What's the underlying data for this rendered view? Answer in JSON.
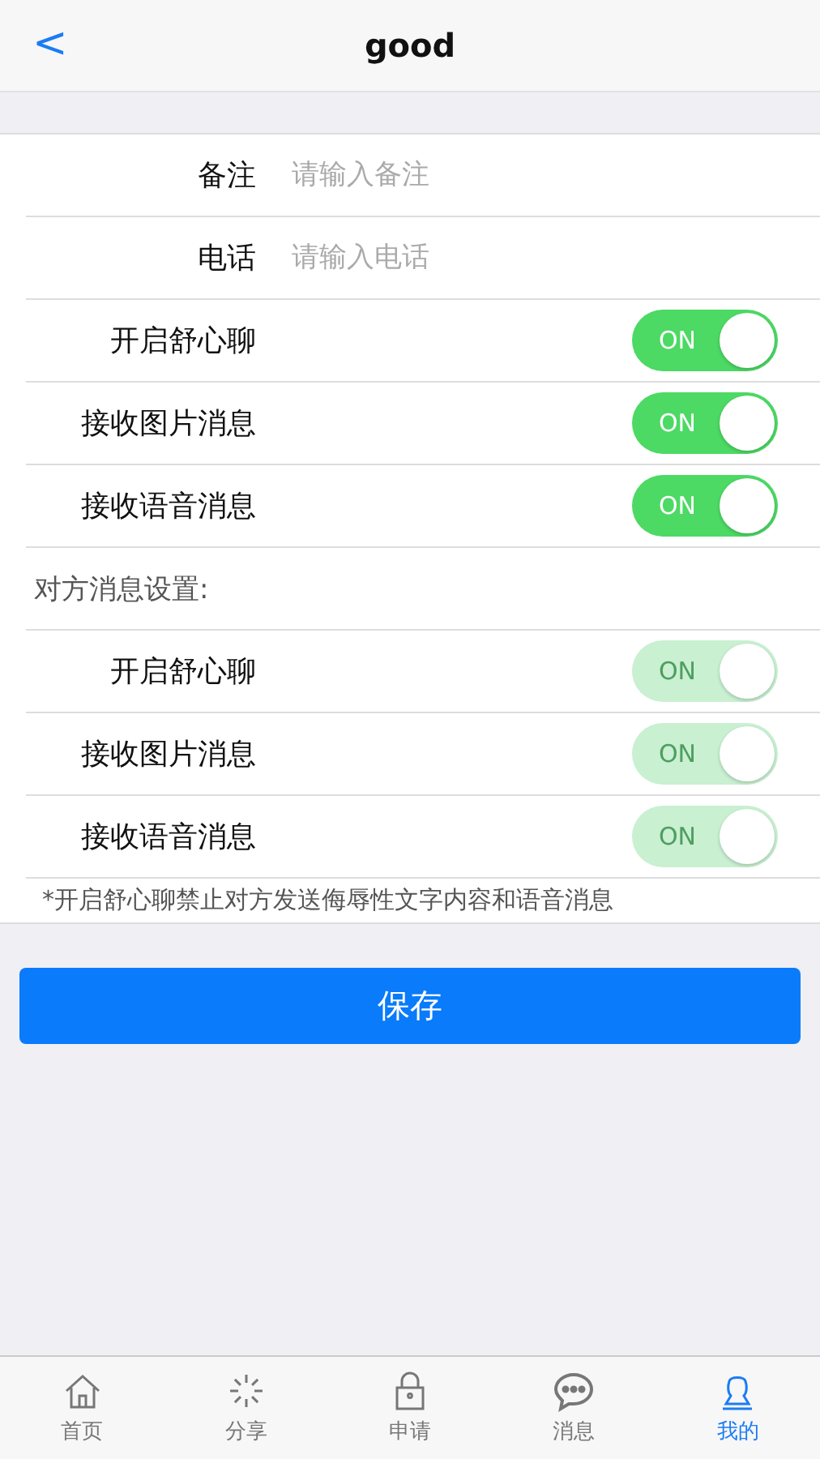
{
  "nav": {
    "back": "<",
    "title": "good"
  },
  "fields": [
    {
      "label": "备注",
      "placeholder": "请输入备注"
    },
    {
      "label": "电话",
      "placeholder": "请输入电话"
    }
  ],
  "my_toggles": [
    {
      "label": "开启舒心聊",
      "on": true,
      "disabled": false,
      "text": "ON"
    },
    {
      "label": "接收图片消息",
      "on": true,
      "disabled": false,
      "text": "ON"
    },
    {
      "label": "接收语音消息",
      "on": true,
      "disabled": false,
      "text": "ON"
    }
  ],
  "peer_section": "对方消息设置:",
  "peer_toggles": [
    {
      "label": "开启舒心聊",
      "on": true,
      "disabled": true,
      "text": "ON"
    },
    {
      "label": "接收图片消息",
      "on": true,
      "disabled": true,
      "text": "ON"
    },
    {
      "label": "接收语音消息",
      "on": true,
      "disabled": true,
      "text": "ON"
    }
  ],
  "note": "*开启舒心聊禁止对方发送侮辱性文字内容和语音消息",
  "save_button": "保存",
  "tabs": [
    {
      "kind": "home",
      "label": "首页",
      "selected": false
    },
    {
      "kind": "share",
      "label": "分享",
      "selected": false
    },
    {
      "kind": "lock",
      "label": "申请",
      "selected": false
    },
    {
      "kind": "chat",
      "label": "消息",
      "selected": false
    },
    {
      "kind": "user",
      "label": "我的",
      "selected": true
    }
  ]
}
